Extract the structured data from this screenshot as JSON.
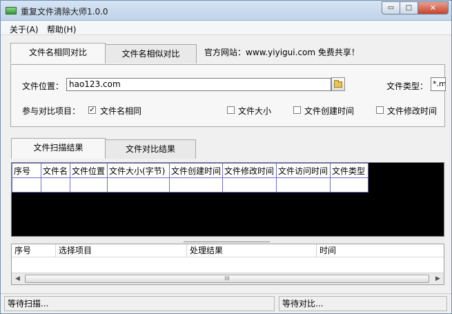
{
  "window": {
    "title": "重复文件清除大师1.0.0",
    "min_glyph": "▭",
    "max_glyph": "□",
    "close_glyph": "✕"
  },
  "menu": {
    "about": "关于(A)",
    "help": "帮助(H)"
  },
  "top_tabs": [
    {
      "label": "文件名相同对比",
      "active": true
    },
    {
      "label": "文件名相似对比",
      "active": false
    }
  ],
  "site_info": "官方网站：www.yiyigui.com 免费共享！",
  "form": {
    "location_label": "文件位置：",
    "location_value": "hao123.com",
    "type_label": "文件类型：",
    "type_value": "*.mp",
    "compare_label": "参与对比项目：",
    "options": [
      {
        "label": "文件名相同",
        "checked": true
      },
      {
        "label": "文件大小",
        "checked": false
      },
      {
        "label": "文件创建时间",
        "checked": false
      },
      {
        "label": "文件修改时间",
        "checked": false
      }
    ]
  },
  "result_tabs": [
    {
      "label": "文件扫描结果",
      "active": true
    },
    {
      "label": "文件对比结果",
      "active": false
    }
  ],
  "results_table": {
    "columns": [
      "序号",
      "文件名",
      "文件位置",
      "文件大小(字节)",
      "文件创建时间",
      "文件修改时间",
      "文件访问时间",
      "文件类型"
    ]
  },
  "bottom_list": {
    "columns": [
      "序号",
      "选择项目",
      "处理结果",
      "时间"
    ]
  },
  "scrollbar": {
    "left_arrow": "◀",
    "right_arrow": "▶",
    "grip": "III"
  },
  "status": {
    "scan": "等待扫描...",
    "compare": "等待对比..."
  }
}
